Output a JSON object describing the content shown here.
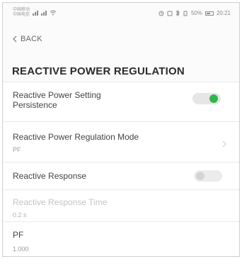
{
  "status_bar": {
    "carrier_top": "中国移动",
    "carrier_bottom": "中国电信",
    "icons_left": [
      "signal-bars-icon",
      "signal-bars-icon",
      "wifi-icon"
    ],
    "icons_right": [
      "alarm-icon",
      "nfc-icon",
      "bluetooth-icon",
      "vibrate-icon"
    ],
    "battery": "50%",
    "time": "20:21"
  },
  "nav": {
    "back_label": "BACK"
  },
  "page": {
    "title": "REACTIVE POWER REGULATION"
  },
  "settings": {
    "persistence": {
      "label_line1": "Reactive Power Setting",
      "label_line2": "Persistence",
      "enabled": true
    },
    "mode": {
      "label": "Reactive Power Regulation Mode",
      "value": "PF"
    },
    "response": {
      "label": "Reactive Response",
      "enabled": false
    },
    "response_time": {
      "label": "Reactive Response Time",
      "value": "0.2 s"
    },
    "pf": {
      "label": "PF",
      "value": "1.000"
    }
  },
  "colors": {
    "accent": "#2eb84b",
    "toggle_off": "#d4d4d4",
    "disabled_text": "#c4c4c4"
  }
}
